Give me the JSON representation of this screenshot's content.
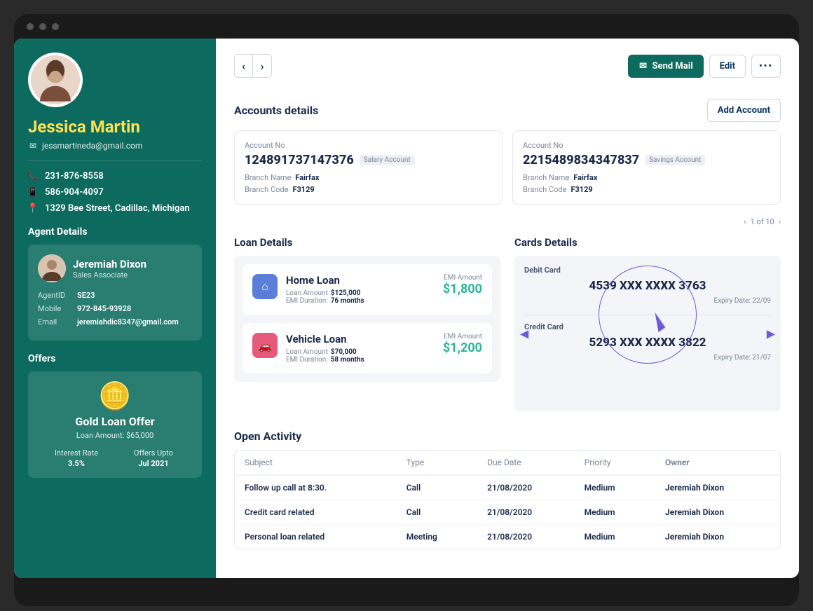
{
  "customer": {
    "name": "Jessica Martin",
    "email": "jessmartineda@gmail.com",
    "phone1": "231-876-8558",
    "phone2": "586-904-4097",
    "address": "1329  Bee Street, Cadillac, Michigan"
  },
  "agent_section_title": "Agent Details",
  "agent": {
    "name": "Jeremiah Dixon",
    "role": "Sales Associate",
    "id_label": "AgentID",
    "id": "SE23",
    "mobile_label": "Mobile",
    "mobile": "972-845-93928",
    "email_label": "Email",
    "email": "jeremiahdic8347@gmail.com"
  },
  "offers_title": "Offers",
  "offer": {
    "title": "Gold Loan Offer",
    "sub": "Loan Amount: $65,000",
    "rate_label": "Interest Rate",
    "rate": "3.5%",
    "upto_label": "Offers Upto",
    "upto": "Jul 2021"
  },
  "toolbar": {
    "send_mail": "Send Mail",
    "edit": "Edit",
    "more": "•••"
  },
  "accounts_title": "Accounts details",
  "add_account_label": "Add Account",
  "accounts": [
    {
      "no_label": "Account No",
      "no": "12489173714737​6",
      "tag": "Salary Account",
      "branch_label": "Branch Name",
      "branch": "Fairfax",
      "code_label": "Branch Code",
      "code": "F3129"
    },
    {
      "no_label": "Account No",
      "no": "2215489834347837",
      "tag": "Savings Account",
      "branch_label": "Branch Name",
      "branch": "Fairfax",
      "code_label": "Branch Code",
      "code": "F3129"
    }
  ],
  "pager": "1 of 10",
  "loans_title": "Loan Details",
  "loans": [
    {
      "name": "Home Loan",
      "amount_label": "Loan Amount",
      "amount": "$125,000",
      "dur_label": "EMI Duration:",
      "dur": "76 months",
      "emi_label": "EMI Amount",
      "emi": "$1,800"
    },
    {
      "name": "Vehicle Loan",
      "amount_label": "Loan Amount",
      "amount": "$70,000",
      "dur_label": "EMI Duration:",
      "dur": "58 months",
      "emi_label": "EMI Amount",
      "emi": "$1,200"
    }
  ],
  "cards_title": "Cards Details",
  "cards": [
    {
      "type": "Debit Card",
      "no": "4539 XXX XXXX 3763",
      "exp_label": "Expiry Date:",
      "exp": "22/09"
    },
    {
      "type": "Credit Card",
      "no": "5293 XXX XXXX 3822",
      "exp_label": "Expiry Date:",
      "exp": "21/07"
    }
  ],
  "activity_title": "Open Activity",
  "activity_headers": {
    "subject": "Subject",
    "type": "Type",
    "due": "Due Date",
    "priority": "Priority",
    "owner": "Owner"
  },
  "activities": [
    {
      "subject": "Follow up call at 8:30.",
      "type": "Call",
      "due": "21/08/2020",
      "priority": "Medium",
      "owner": "Jeremiah Dixon"
    },
    {
      "subject": "Credit card related",
      "type": "Call",
      "due": "21/08/2020",
      "priority": "Medium",
      "owner": "Jeremiah Dixon"
    },
    {
      "subject": "Personal loan related",
      "type": "Meeting",
      "due": "21/08/2020",
      "priority": "Medium",
      "owner": "Jeremiah Dixon"
    }
  ]
}
